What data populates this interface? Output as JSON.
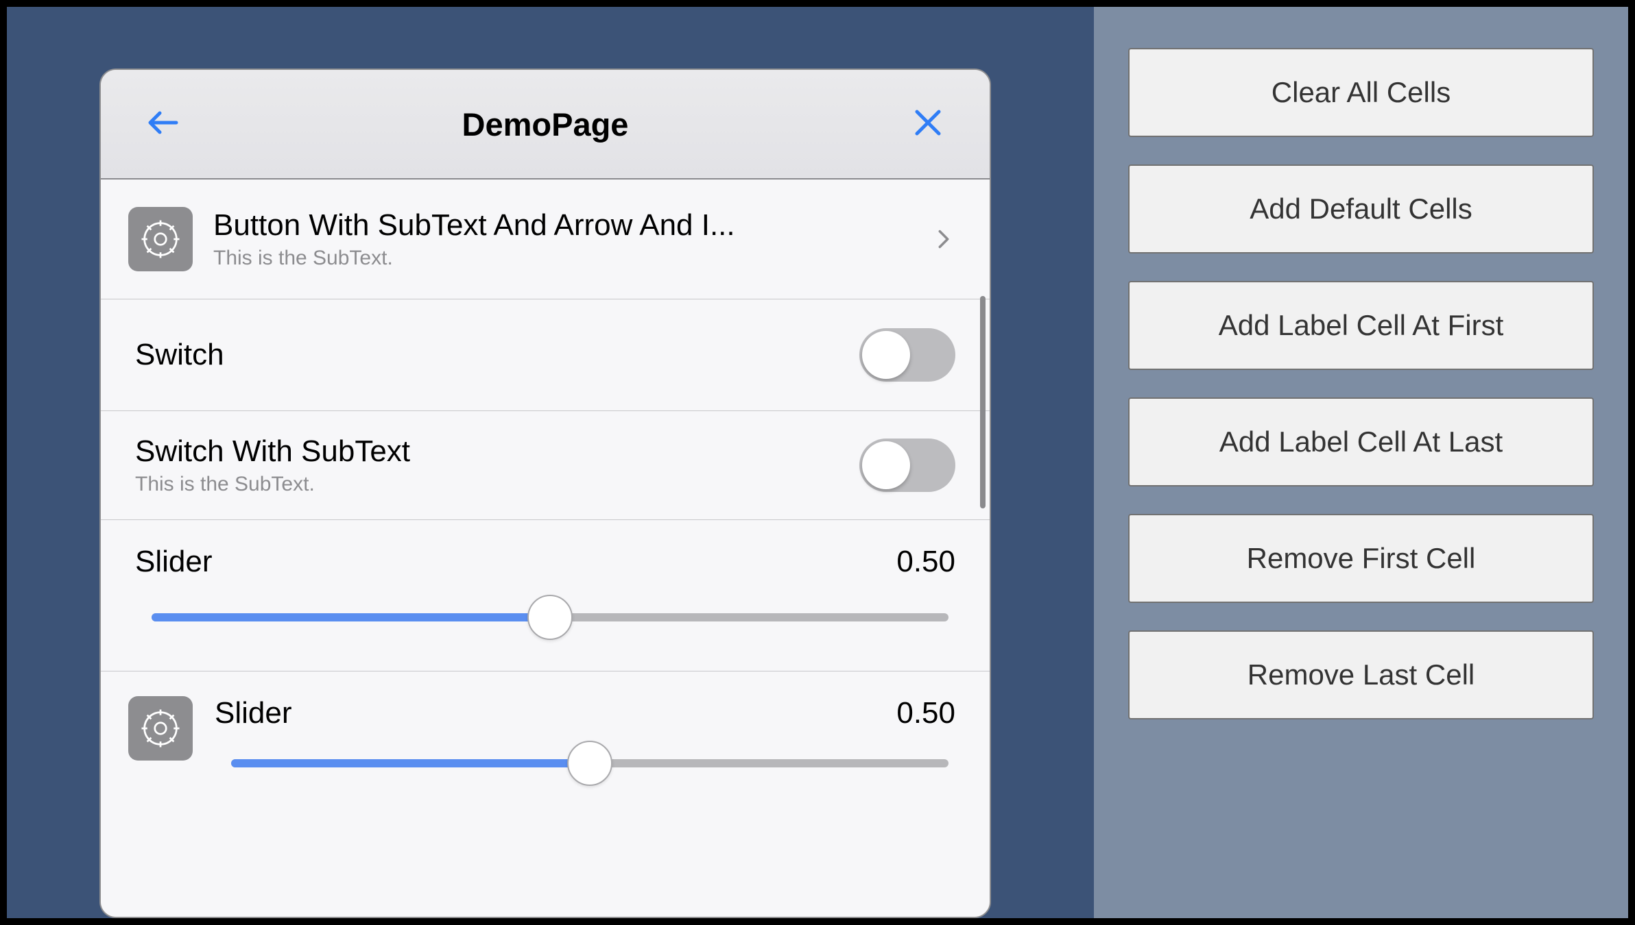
{
  "page": {
    "title": "DemoPage",
    "cells": {
      "button": {
        "title": "Button With SubText And Arrow And I...",
        "subtext": "This is the SubText."
      },
      "switch1": {
        "title": "Switch",
        "on": false
      },
      "switch2": {
        "title": "Switch With SubText",
        "subtext": "This is the SubText.",
        "on": false
      },
      "slider1": {
        "title": "Slider",
        "value_text": "0.50",
        "value": 0.5
      },
      "slider2": {
        "title": "Slider",
        "value_text": "0.50",
        "value": 0.5
      }
    }
  },
  "sidebar": {
    "buttons": [
      "Clear All Cells",
      "Add Default Cells",
      "Add Label Cell At First",
      "Add Label Cell At Last",
      "Remove First Cell",
      "Remove Last Cell"
    ]
  },
  "icons": {
    "back": "back-arrow-icon",
    "close": "close-icon",
    "gear": "gear-icon",
    "chevron": "chevron-right-icon"
  }
}
